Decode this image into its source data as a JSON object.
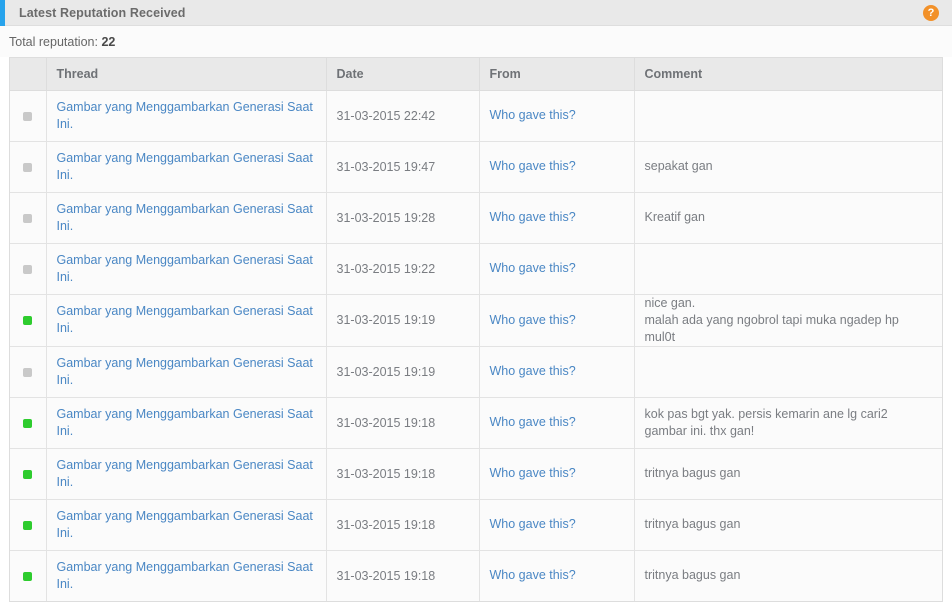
{
  "header": {
    "title": "Latest Reputation Received",
    "help_icon": "question-mark-icon",
    "help_label": "?",
    "accent_color": "#27a3ec",
    "help_color": "#f29129"
  },
  "summary": {
    "label": "Total reputation:",
    "value": "22"
  },
  "table": {
    "columns": {
      "status": "",
      "thread": "Thread",
      "date": "Date",
      "from": "From",
      "comment": "Comment"
    },
    "link_color": "#4a87c4",
    "positive_color": "#2ecc2e",
    "neutral_color": "#c9c9c9",
    "rows": [
      {
        "status": "neutral",
        "thread": "Gambar yang Menggambarkan Generasi Saat Ini.",
        "date": "31-03-2015 22:42",
        "from": "Who gave this?",
        "comment": ""
      },
      {
        "status": "neutral",
        "thread": "Gambar yang Menggambarkan Generasi Saat Ini.",
        "date": "31-03-2015 19:47",
        "from": "Who gave this?",
        "comment": "sepakat gan"
      },
      {
        "status": "neutral",
        "thread": "Gambar yang Menggambarkan Generasi Saat Ini.",
        "date": "31-03-2015 19:28",
        "from": "Who gave this?",
        "comment": "Kreatif gan"
      },
      {
        "status": "neutral",
        "thread": "Gambar yang Menggambarkan Generasi Saat Ini.",
        "date": "31-03-2015 19:22",
        "from": "Who gave this?",
        "comment": ""
      },
      {
        "status": "positive",
        "thread": "Gambar yang Menggambarkan Generasi Saat Ini.",
        "date": "31-03-2015 19:19",
        "from": "Who gave this?",
        "comment": "nice gan.\nmalah ada yang ngobrol tapi muka ngadep hp mul0t"
      },
      {
        "status": "neutral",
        "thread": "Gambar yang Menggambarkan Generasi Saat Ini.",
        "date": "31-03-2015 19:19",
        "from": "Who gave this?",
        "comment": ""
      },
      {
        "status": "positive",
        "thread": "Gambar yang Menggambarkan Generasi Saat Ini.",
        "date": "31-03-2015 19:18",
        "from": "Who gave this?",
        "comment": "kok pas bgt yak. persis kemarin ane lg cari2 gambar ini. thx gan!"
      },
      {
        "status": "positive",
        "thread": "Gambar yang Menggambarkan Generasi Saat Ini.",
        "date": "31-03-2015 19:18",
        "from": "Who gave this?",
        "comment": "tritnya bagus gan"
      },
      {
        "status": "positive",
        "thread": "Gambar yang Menggambarkan Generasi Saat Ini.",
        "date": "31-03-2015 19:18",
        "from": "Who gave this?",
        "comment": "tritnya bagus gan"
      },
      {
        "status": "positive",
        "thread": "Gambar yang Menggambarkan Generasi Saat Ini.",
        "date": "31-03-2015 19:18",
        "from": "Who gave this?",
        "comment": "tritnya bagus gan"
      }
    ]
  }
}
